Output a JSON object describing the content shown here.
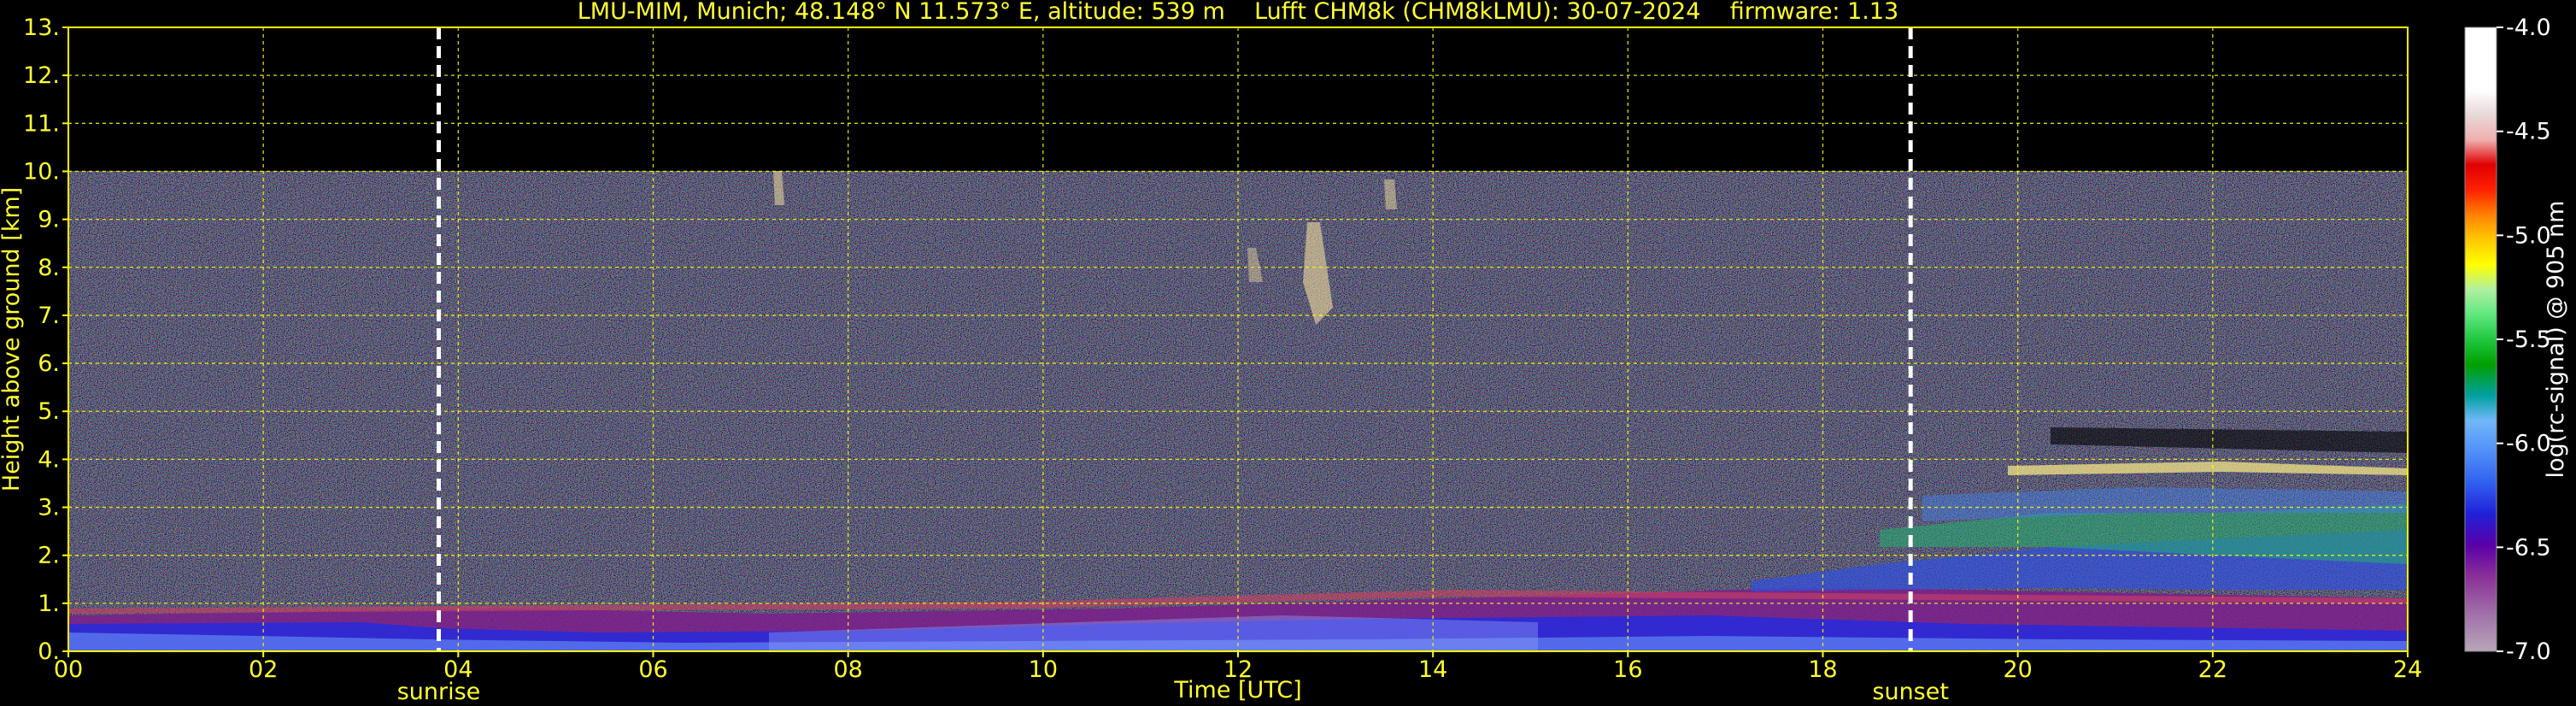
{
  "chart_data": {
    "type": "heatmap",
    "title": "LMU-MIM, Munich; 48.148° N 11.573° E, altitude: 539 m    Lufft CHM8k (CHM8kLMU): 30-07-2024    firmware: 1.13",
    "xlabel": "Time [UTC]",
    "ylabel": "Height above ground [km]",
    "xlim": [
      0,
      24
    ],
    "ylim": [
      0,
      13
    ],
    "x_ticks": [
      "00",
      "02",
      "04",
      "06",
      "08",
      "10",
      "12",
      "14",
      "16",
      "18",
      "20",
      "22",
      "24"
    ],
    "y_ticks": [
      "0.",
      "1.",
      "2.",
      "3.",
      "4.",
      "5.",
      "6.",
      "7.",
      "8.",
      "9.",
      "10.",
      "11.",
      "12.",
      "13."
    ],
    "grid": true,
    "data_top_km": 10,
    "events": [
      {
        "label": "sunrise",
        "time": 3.8
      },
      {
        "label": "sunset",
        "time": 18.9
      }
    ],
    "colorbar": {
      "label": "log(rc-signal) @ 905 nm",
      "ticks": [
        "-4.0",
        "-4.5",
        "-5.0",
        "-5.5",
        "-6.0",
        "-6.5",
        "-7.0"
      ],
      "range": [
        -7.0,
        -4.0
      ]
    },
    "colors": {
      "text": "#ffff33",
      "grid": "#ffff00",
      "event_line": "#ffffff",
      "background": "#000000"
    }
  }
}
